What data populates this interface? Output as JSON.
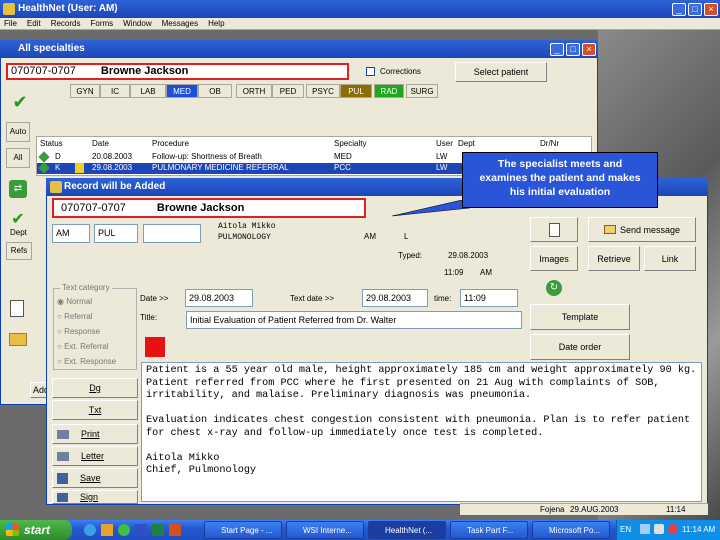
{
  "app": {
    "title": "HealthNet (User: AM)",
    "menu": [
      "File",
      "Edit",
      "Records",
      "Forms",
      "Window",
      "Messages",
      "Help"
    ]
  },
  "specialties": {
    "title": "All specialties",
    "patient_id": "070707-0707",
    "patient_name": "Browne Jackson",
    "corrections_label": "Corrections",
    "select_patient": "Select patient",
    "tabs": [
      "GYN",
      "IC",
      "LAB",
      "MED",
      "OB",
      "ORTH",
      "PED",
      "PSYC",
      "PUL",
      "RAD",
      "SURG"
    ],
    "side_buttons": [
      "Auto",
      "All",
      "Dept",
      "Add",
      "Refs"
    ],
    "columns": [
      "Status",
      "Date",
      "Procedure",
      "Specialty",
      "User",
      "Dept",
      "Dr/Nr"
    ],
    "rows": [
      {
        "status": "D",
        "date": "20.08.2003",
        "procedure": "Follow-up: Shortness of Breath",
        "specialty": "MED",
        "user": "LW"
      },
      {
        "status": "K",
        "date": "29.08.2003",
        "procedure": "PULMONARY MEDICINE REFERRAL",
        "specialty": "PCC",
        "user": "LW"
      }
    ],
    "add_button": "Add"
  },
  "callout": {
    "text": "The specialist meets and examines the patient and makes his initial evaluation"
  },
  "record": {
    "title": "Record will be Added",
    "patient_id": "070707-0707",
    "patient_name": "Browne Jackson",
    "user": "AM",
    "dept": "PUL",
    "doctor_name": "Aitola Mikko",
    "doctor_dept": "PULMONOLOGY",
    "user2": "AM",
    "status_code": "L",
    "typed_label": "Typed:",
    "typed_date": "29.08.2003",
    "typed_time": "11:09",
    "typed_ampm": "AM",
    "text_category_label": "Text category",
    "categories": [
      "Normal",
      "Referral",
      "Response",
      "Ext. Referral",
      "Ext. Response"
    ],
    "date_label": "Date >>",
    "date_value": "29.08.2003",
    "text_date_label": "Text date >>",
    "text_date_value": "29.08.2003",
    "time_label": "time:",
    "time_value": "11:09",
    "title_label": "Title:",
    "title_value": "Initial Evaluation of Patient Referred from Dr. Walter",
    "buttons": {
      "send_message": "Send message",
      "images": "Images",
      "retrieve": "Retrieve",
      "link": "Link",
      "template": "Template",
      "date_order": "Date order",
      "dg": "Dg",
      "txt": "Txt",
      "print": "Print",
      "letter": "Letter",
      "save": "Save",
      "sign": "Sign"
    },
    "body_text": "Patient is a 55 year old male, height approximately 185 cm and weight approximately 90 kg. Patient referred from PCC where he first presented on 21 Aug with complaints of SOB, irritability, and malaise. Preliminary diagnosis was pneumonia.\n\nEvaluation indicates chest congestion consistent with pneumonia. Plan is to refer patient for chest x-ray and follow-up immediately once test is completed.\n\nAitola Mikko\nChief, Pulmonology",
    "status_left": "Fojena",
    "status_date": "29.AUG.2003",
    "status_time": "11:14"
  },
  "taskbar": {
    "start": "start",
    "tasks": [
      "Start Page - ...",
      "WSI Interne...",
      "HealthNet (...",
      "Task Part F...",
      "Microsoft Po..."
    ],
    "lang": "EN",
    "clock": "11:14 AM"
  },
  "colors": {
    "title_blue": "#1c46b8",
    "highlight_red": "#e02020",
    "tab_med": "#1e4fd8",
    "tab_pul": "#8b6d00",
    "tab_rad": "#1fa71f",
    "callout": "#2a55d8",
    "taskbar": "#2459d0",
    "start_green": "#3a9b3a"
  }
}
